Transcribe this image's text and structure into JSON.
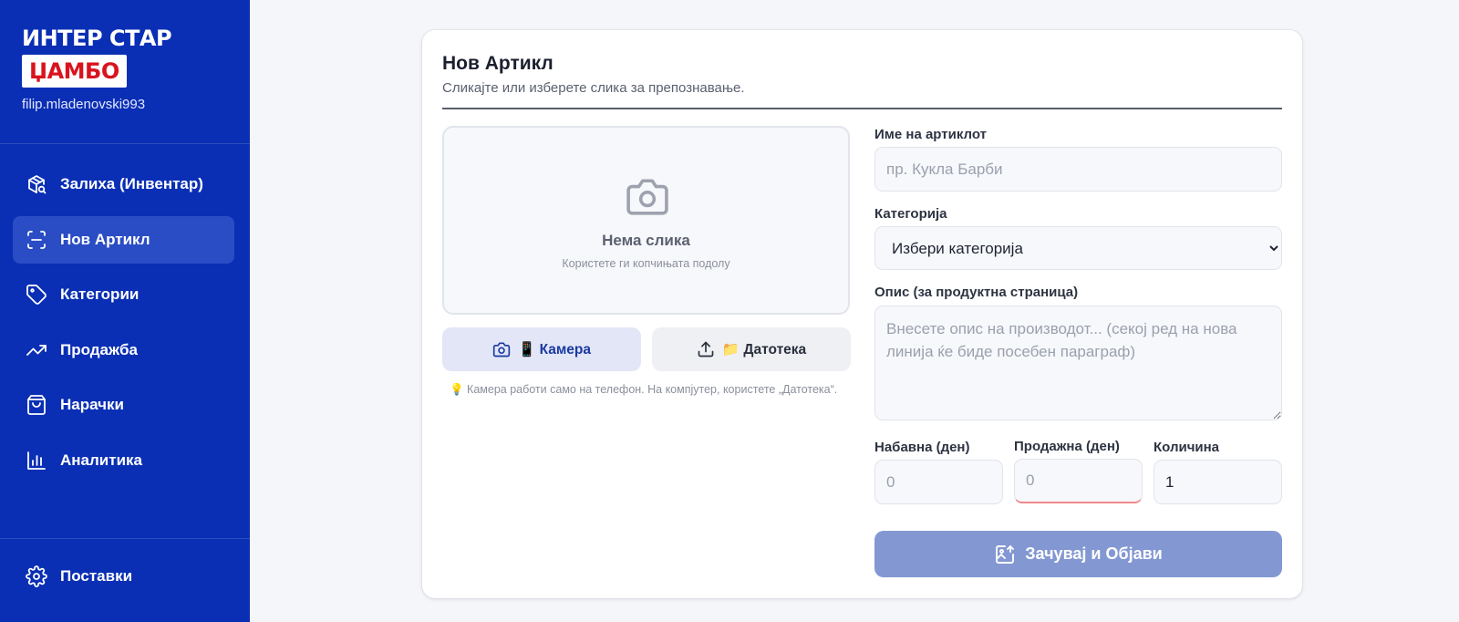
{
  "brand": {
    "title": "ИНТЕР СТАР",
    "logo": "ЏАМБО",
    "user": "filip.mladenovski993"
  },
  "sidebar": {
    "items": [
      {
        "label": "Залиха (Инвентар)",
        "icon": "inventory-box-icon"
      },
      {
        "label": "Нов Артикл",
        "icon": "scan-icon",
        "active": true
      },
      {
        "label": "Категории",
        "icon": "tag-icon"
      },
      {
        "label": "Продажба",
        "icon": "trending-up-icon"
      },
      {
        "label": "Нарачки",
        "icon": "shopping-bag-icon"
      },
      {
        "label": "Аналитика",
        "icon": "bar-chart-icon"
      }
    ],
    "settings": {
      "label": "Поставки",
      "icon": "gear-icon"
    }
  },
  "form": {
    "title": "Нов Артикл",
    "subtitle": "Сликајте или изберете слика за препознавање.",
    "image": {
      "empty_title": "Нема слика",
      "empty_sub": "Користете ги копчињата подолу",
      "camera_label": "📱 Камера",
      "file_label": "📁 Датотека",
      "hint": "💡  Камера работи само на телефон. На компјутер, користете „Датотека“."
    },
    "name": {
      "label": "Име на артиклот",
      "placeholder": "пр. Кукла Барби",
      "value": ""
    },
    "category": {
      "label": "Категорија",
      "selected": "Избери категорија"
    },
    "description": {
      "label": "Опис (за продуктна страница)",
      "placeholder": "Внесете опис на производот... (секој ред на нова линија ќе биде посебен параграф)"
    },
    "purchase_price": {
      "label": "Набавна (ден)",
      "placeholder": "0"
    },
    "sale_price": {
      "label": "Продажна (ден)",
      "placeholder": "0"
    },
    "quantity": {
      "label": "Количина",
      "value": "1"
    },
    "submit_label": "Зачувај и Објави"
  },
  "colors": {
    "sidebar": "#0a2fb4",
    "active_item": "#2a4cc4",
    "submit": "#8398d2",
    "logo_red": "#d9141e"
  }
}
